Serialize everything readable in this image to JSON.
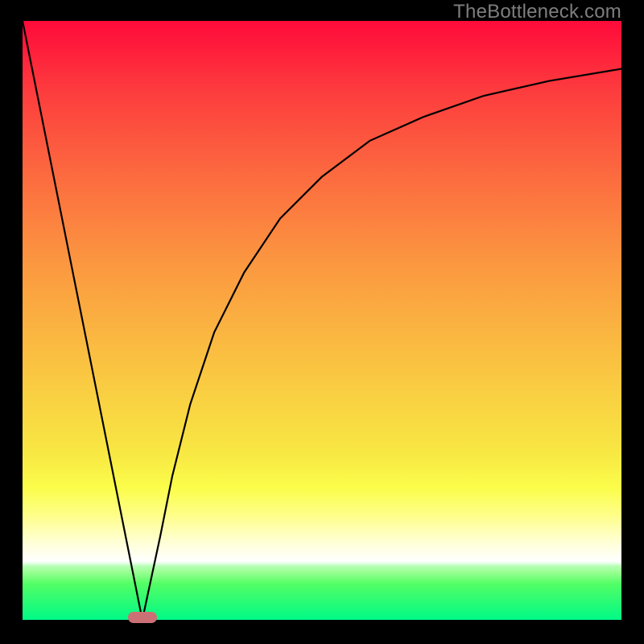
{
  "watermark": "TheBottleneck.com",
  "colors": {
    "page_bg": "#000000",
    "nub": "#cb7075",
    "curve": "#000000"
  },
  "chart_data": {
    "type": "line",
    "title": "",
    "xlabel": "",
    "ylabel": "",
    "xlim": [
      0,
      100
    ],
    "ylim": [
      0,
      100
    ],
    "grid": false,
    "legend": false,
    "note": "Values estimated from pixel positions; chart has no labeled ticks. Curve is a V-shaped function with a sharp minimum near x≈20, steep linear left arm and decelerating right arm.",
    "series": [
      {
        "name": "curve",
        "x": [
          0,
          5,
          10,
          15,
          17,
          18.5,
          20,
          21.5,
          23,
          25,
          28,
          32,
          37,
          43,
          50,
          58,
          67,
          77,
          88,
          100
        ],
        "values": [
          100,
          75,
          50,
          25,
          15,
          7.5,
          0,
          7,
          14,
          24,
          36,
          48,
          58,
          67,
          74,
          80,
          84,
          87.5,
          90,
          92
        ]
      }
    ],
    "marker": {
      "x": 20,
      "y": 0
    }
  }
}
